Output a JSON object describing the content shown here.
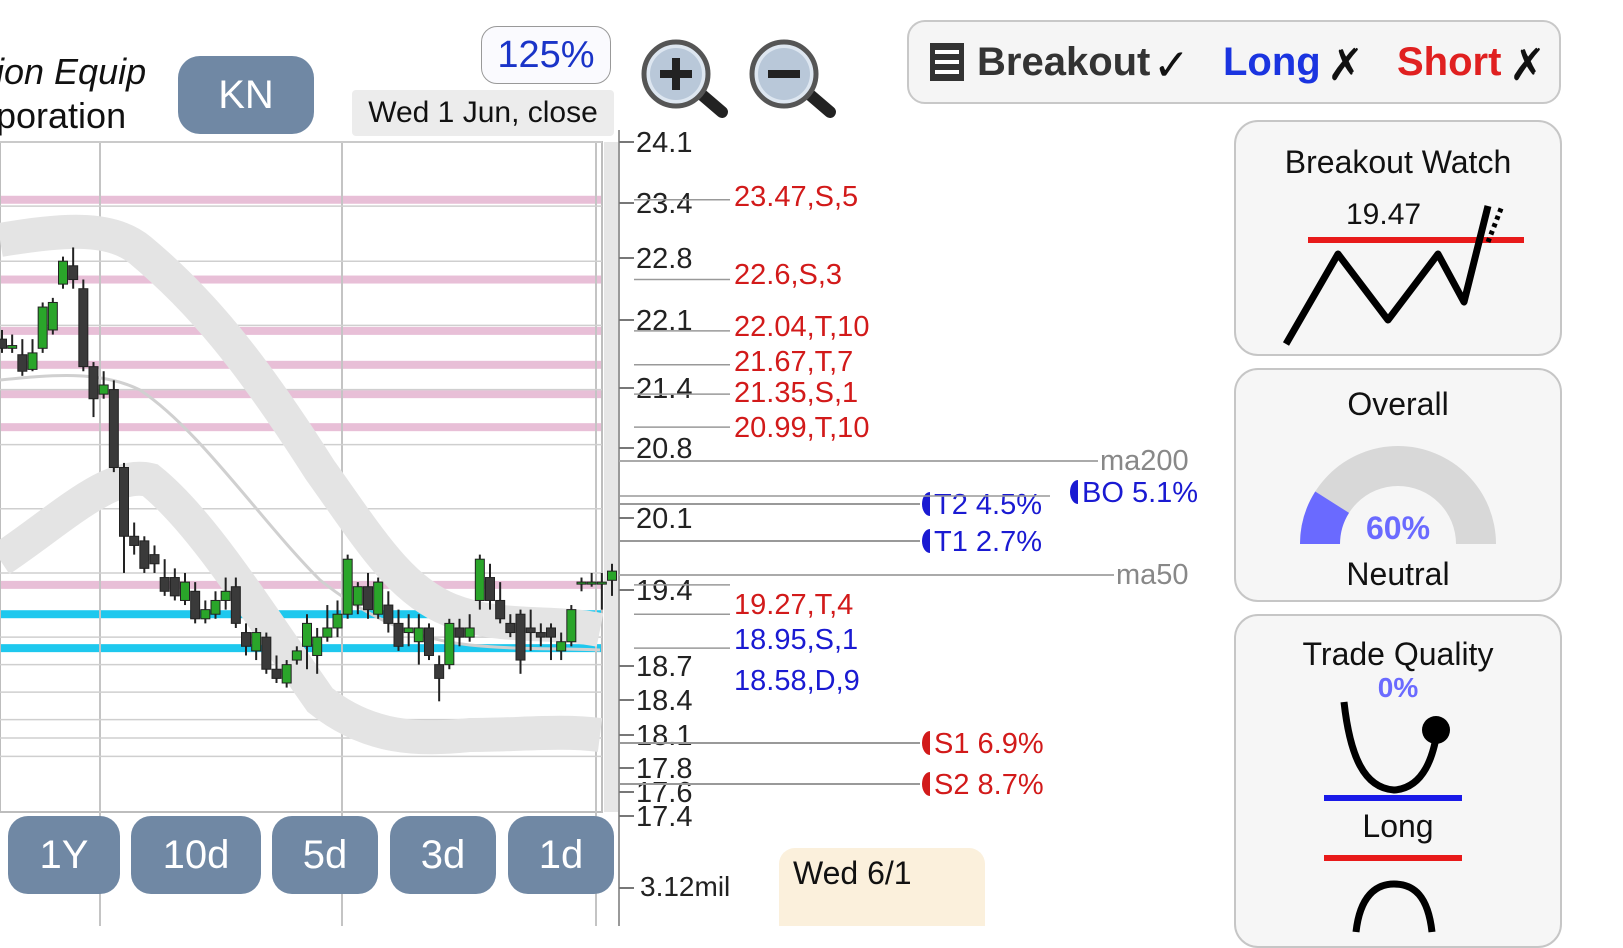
{
  "header": {
    "company_line1": "ion Equip",
    "company_line2": "poration",
    "ticker": "KN",
    "zoom_level": "125%",
    "date_label": "Wed 1 Jun, close"
  },
  "legend": {
    "breakout_label": "Breakout",
    "breakout_mark": "✓",
    "long_label": "Long",
    "long_mark": "✗",
    "short_label": "Short",
    "short_mark": "✗"
  },
  "chart_data": {
    "type": "candlestick",
    "y_ticks": [
      "24.1",
      "23.4",
      "22.8",
      "22.1",
      "21.4",
      "20.8",
      "20.1",
      "19.4",
      "18.7",
      "18.4",
      "18.1",
      "17.8",
      "17.6",
      "17.4"
    ],
    "volume_label": "3.12mil",
    "levels": [
      {
        "label": "23.47,S,5",
        "value": 23.47,
        "color": "#d21a1a",
        "band": "pink"
      },
      {
        "label": "22.6,S,3",
        "value": 22.6,
        "color": "#d21a1a",
        "band": "pink"
      },
      {
        "label": "22.04,T,10",
        "value": 22.04,
        "color": "#d21a1a",
        "band": "pink"
      },
      {
        "label": "21.67,T,7",
        "value": 21.67,
        "color": "#d21a1a",
        "band": "pink"
      },
      {
        "label": "21.35,S,1",
        "value": 21.35,
        "color": "#d21a1a",
        "band": "pink"
      },
      {
        "label": "20.99,T,10",
        "value": 20.99,
        "color": "#d21a1a",
        "band": "pink"
      },
      {
        "label": "19.27,T,4",
        "value": 19.27,
        "color": "#d21a1a",
        "band": "pink"
      },
      {
        "label": "18.95,S,1",
        "value": 18.95,
        "color": "#1a1ad2",
        "band": "cyan"
      },
      {
        "label": "18.58,D,9",
        "value": 18.58,
        "color": "#1a1ad2",
        "band": "cyan"
      }
    ],
    "moving_averages": [
      {
        "label": "ma200",
        "value": 20.7
      },
      {
        "label": "ma50",
        "value": 19.55
      }
    ],
    "targets": [
      {
        "label": "T2 4.5%",
        "value": 20.15,
        "color": "#1a1ad2"
      },
      {
        "label": "T1 2.7%",
        "value": 19.8,
        "color": "#1a1ad2"
      },
      {
        "label": "BO 5.1%",
        "value": 20.35,
        "color": "#1a1ad2"
      },
      {
        "label": "S1 6.9%",
        "value": 18.09,
        "color": "#d21a1a"
      },
      {
        "label": "S2 8.7%",
        "value": 17.72,
        "color": "#d21a1a"
      }
    ],
    "candles": [
      {
        "o": 21.95,
        "h": 22.05,
        "c": 21.85,
        "l": 21.8
      },
      {
        "o": 21.85,
        "h": 22.0,
        "c": 21.88,
        "l": 21.8
      },
      {
        "o": 21.78,
        "h": 21.95,
        "c": 21.6,
        "l": 21.55
      },
      {
        "o": 21.62,
        "h": 21.95,
        "c": 21.8,
        "l": 21.6
      },
      {
        "o": 21.85,
        "h": 22.35,
        "c": 22.3,
        "l": 21.8
      },
      {
        "o": 22.05,
        "h": 22.4,
        "c": 22.35,
        "l": 22.0
      },
      {
        "o": 22.55,
        "h": 22.85,
        "c": 22.8,
        "l": 22.5
      },
      {
        "o": 22.75,
        "h": 22.95,
        "c": 22.6,
        "l": 22.5
      },
      {
        "o": 22.5,
        "h": 22.6,
        "c": 21.65,
        "l": 21.6
      },
      {
        "o": 21.65,
        "h": 21.7,
        "c": 21.3,
        "l": 21.1
      },
      {
        "o": 21.35,
        "h": 21.6,
        "c": 21.45,
        "l": 21.3
      },
      {
        "o": 21.4,
        "h": 21.5,
        "c": 20.55,
        "l": 20.5
      },
      {
        "o": 20.55,
        "h": 20.6,
        "c": 19.8,
        "l": 19.4
      },
      {
        "o": 19.8,
        "h": 19.95,
        "c": 19.7,
        "l": 19.6
      },
      {
        "o": 19.75,
        "h": 19.8,
        "c": 19.45,
        "l": 19.4
      },
      {
        "o": 19.6,
        "h": 19.7,
        "c": 19.5,
        "l": 19.4
      },
      {
        "o": 19.35,
        "h": 19.55,
        "c": 19.2,
        "l": 19.15
      },
      {
        "o": 19.35,
        "h": 19.45,
        "c": 19.15,
        "l": 19.1
      },
      {
        "o": 19.1,
        "h": 19.4,
        "c": 19.3,
        "l": 19.05
      },
      {
        "o": 19.2,
        "h": 19.3,
        "c": 18.9,
        "l": 18.85
      },
      {
        "o": 18.9,
        "h": 19.1,
        "c": 19.0,
        "l": 18.85
      },
      {
        "o": 18.95,
        "h": 19.2,
        "c": 19.1,
        "l": 18.9
      },
      {
        "o": 19.1,
        "h": 19.35,
        "c": 19.2,
        "l": 19.0
      },
      {
        "o": 19.25,
        "h": 19.35,
        "c": 18.85,
        "l": 18.8
      },
      {
        "o": 18.75,
        "h": 18.85,
        "c": 18.6,
        "l": 18.5
      },
      {
        "o": 18.55,
        "h": 18.8,
        "c": 18.75,
        "l": 18.45
      },
      {
        "o": 18.7,
        "h": 18.75,
        "c": 18.35,
        "l": 18.3
      },
      {
        "o": 18.35,
        "h": 18.5,
        "c": 18.25,
        "l": 18.2
      },
      {
        "o": 18.2,
        "h": 18.45,
        "c": 18.4,
        "l": 18.15
      },
      {
        "o": 18.45,
        "h": 18.6,
        "c": 18.55,
        "l": 18.4
      },
      {
        "o": 18.6,
        "h": 18.95,
        "c": 18.85,
        "l": 18.35
      },
      {
        "o": 18.5,
        "h": 18.8,
        "c": 18.7,
        "l": 18.3
      },
      {
        "o": 18.7,
        "h": 19.05,
        "c": 18.8,
        "l": 18.65
      },
      {
        "o": 18.8,
        "h": 19.1,
        "c": 18.95,
        "l": 18.7
      },
      {
        "o": 18.95,
        "h": 19.6,
        "c": 19.55,
        "l": 18.9
      },
      {
        "o": 19.05,
        "h": 19.3,
        "c": 19.25,
        "l": 18.95
      },
      {
        "o": 19.25,
        "h": 19.4,
        "c": 19.0,
        "l": 18.9
      },
      {
        "o": 18.95,
        "h": 19.35,
        "c": 19.3,
        "l": 18.9
      },
      {
        "o": 19.05,
        "h": 19.2,
        "c": 18.85,
        "l": 18.75
      },
      {
        "o": 18.85,
        "h": 19.0,
        "c": 18.6,
        "l": 18.55
      },
      {
        "o": 18.75,
        "h": 18.95,
        "c": 18.8,
        "l": 18.6
      },
      {
        "o": 18.65,
        "h": 18.95,
        "c": 18.8,
        "l": 18.4
      },
      {
        "o": 18.8,
        "h": 18.85,
        "c": 18.5,
        "l": 18.45
      },
      {
        "o": 18.4,
        "h": 18.5,
        "c": 18.25,
        "l": 18.0
      },
      {
        "o": 18.4,
        "h": 18.9,
        "c": 18.85,
        "l": 18.35
      },
      {
        "o": 18.8,
        "h": 18.9,
        "c": 18.7,
        "l": 18.6
      },
      {
        "o": 18.7,
        "h": 18.95,
        "c": 18.8,
        "l": 18.65
      },
      {
        "o": 19.1,
        "h": 19.6,
        "c": 19.55,
        "l": 19.0
      },
      {
        "o": 19.35,
        "h": 19.5,
        "c": 19.1,
        "l": 19.0
      },
      {
        "o": 19.1,
        "h": 19.3,
        "c": 18.9,
        "l": 18.85
      },
      {
        "o": 18.85,
        "h": 18.95,
        "c": 18.75,
        "l": 18.7
      },
      {
        "o": 18.95,
        "h": 19.0,
        "c": 18.45,
        "l": 18.3
      },
      {
        "o": 18.8,
        "h": 19.0,
        "c": 18.75,
        "l": 18.55
      },
      {
        "o": 18.75,
        "h": 18.85,
        "c": 18.7,
        "l": 18.6
      },
      {
        "o": 18.8,
        "h": 18.85,
        "c": 18.7,
        "l": 18.45
      },
      {
        "o": 18.55,
        "h": 18.75,
        "c": 18.65,
        "l": 18.45
      },
      {
        "o": 18.65,
        "h": 19.05,
        "c": 19.0,
        "l": 18.6
      },
      {
        "o": 19.3,
        "h": 19.35,
        "c": 19.3,
        "l": 19.2
      },
      {
        "o": 19.3,
        "h": 19.4,
        "c": 19.3,
        "l": 19.25
      },
      {
        "o": 19.3,
        "h": 19.4,
        "c": 19.3,
        "l": 19.0
      },
      {
        "o": 19.32,
        "h": 19.5,
        "c": 19.42,
        "l": 19.15
      }
    ]
  },
  "range_buttons": [
    "1Y",
    "10d",
    "5d",
    "3d",
    "1d"
  ],
  "bottom_date": "Wed 6/1",
  "panels": {
    "breakout_watch": {
      "title": "Breakout Watch",
      "price": "19.47"
    },
    "overall": {
      "title": "Overall",
      "value": "60%",
      "percent": 60,
      "label": "Neutral"
    },
    "trade_quality": {
      "title": "Trade Quality",
      "value": "0%",
      "label": "Long"
    }
  },
  "colors": {
    "accent_blue": "#1a34c8",
    "red": "#d21a1a",
    "green_candle": "#2aa52a",
    "dark_candle": "#3a3a3a",
    "pink_band": "#e8bfd7",
    "cyan_band": "#1ec8ee",
    "gauge_fill": "#6a6aff",
    "pill": "#7088a4"
  }
}
